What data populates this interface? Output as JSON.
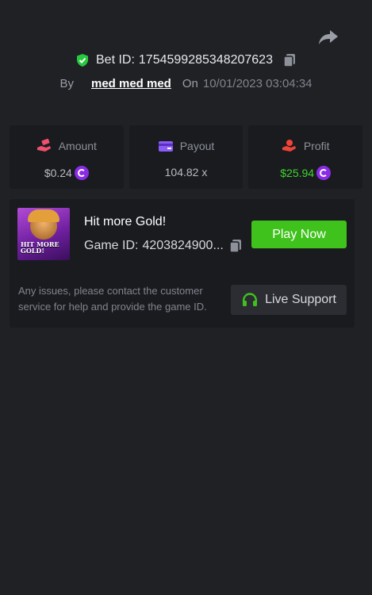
{
  "header": {
    "share_icon": "share-icon",
    "bet_id_label": "Bet ID:",
    "bet_id_value": "1754599285348207623",
    "by_label": "By",
    "username": "med med med",
    "on_label": "On",
    "timestamp": "10/01/2023 03:04:34"
  },
  "stats": {
    "amount": {
      "label": "Amount",
      "value": "$0.24",
      "icon": "money-hand-icon"
    },
    "payout": {
      "label": "Payout",
      "value": "104.82 x",
      "icon": "card-icon"
    },
    "profit": {
      "label": "Profit",
      "value": "$25.94",
      "icon": "profit-hand-icon"
    }
  },
  "game": {
    "thumbnail_text": "HIT MORE GOLD!",
    "title": "Hit more Gold!",
    "game_id_label": "Game ID:",
    "game_id_value": "4203824900...",
    "play_label": "Play Now",
    "issues_text": "Any issues, please contact the customer service for help and provide the game ID.",
    "support_label": "Live Support"
  },
  "colors": {
    "background": "#202125",
    "panel": "#1a1b1f",
    "accent_green": "#3fc21c",
    "profit_green": "#3fd62c",
    "coin_purple": "#8a2ce6",
    "verified_green": "#27c93f"
  }
}
